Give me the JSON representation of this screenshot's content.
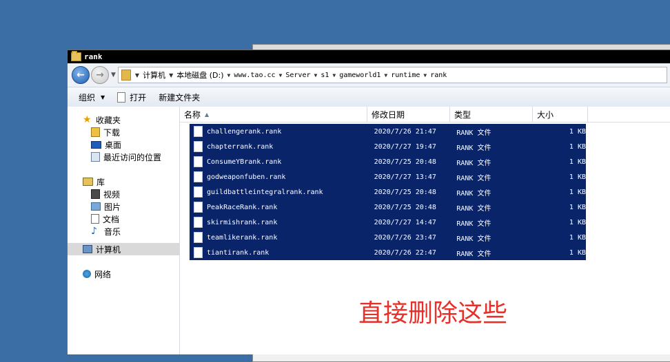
{
  "window": {
    "title": "rank"
  },
  "address": {
    "segments": [
      "计算机",
      "本地磁盘 (D:)",
      "www.tao.cc",
      "Server",
      "s1",
      "gameworld1",
      "runtime",
      "rank"
    ]
  },
  "toolbar": {
    "organize": "组织",
    "open": "打开",
    "new_folder": "新建文件夹"
  },
  "sidebar": {
    "favorites": "收藏夹",
    "downloads": "下载",
    "desktop": "桌面",
    "recent": "最近访问的位置",
    "libraries": "库",
    "videos": "视频",
    "pictures": "图片",
    "documents": "文档",
    "music": "音乐",
    "computer": "计算机",
    "network": "网络"
  },
  "columns": {
    "name": "名称",
    "date": "修改日期",
    "type": "类型",
    "size": "大小"
  },
  "files": [
    {
      "name": "challengerank.rank",
      "date": "2020/7/26 21:47",
      "type": "RANK 文件",
      "size": "1 KB"
    },
    {
      "name": "chapterrank.rank",
      "date": "2020/7/27 19:47",
      "type": "RANK 文件",
      "size": "1 KB"
    },
    {
      "name": "ConsumeYBrank.rank",
      "date": "2020/7/25 20:48",
      "type": "RANK 文件",
      "size": "1 KB"
    },
    {
      "name": "godweaponfuben.rank",
      "date": "2020/7/27 13:47",
      "type": "RANK 文件",
      "size": "1 KB"
    },
    {
      "name": "guildbattleintegralrank.rank",
      "date": "2020/7/25 20:48",
      "type": "RANK 文件",
      "size": "1 KB"
    },
    {
      "name": "PeakRaceRank.rank",
      "date": "2020/7/25 20:48",
      "type": "RANK 文件",
      "size": "1 KB"
    },
    {
      "name": "skirmishrank.rank",
      "date": "2020/7/27 14:47",
      "type": "RANK 文件",
      "size": "1 KB"
    },
    {
      "name": "teamlikerank.rank",
      "date": "2020/7/26 23:47",
      "type": "RANK 文件",
      "size": "1 KB"
    },
    {
      "name": "tiantirank.rank",
      "date": "2020/7/26 22:47",
      "type": "RANK 文件",
      "size": "1 KB"
    }
  ],
  "annotation": "直接删除这些",
  "colors": {
    "desktop": "#3a6ea5",
    "selection": "#0a246a",
    "annotation": "#e8302a"
  }
}
